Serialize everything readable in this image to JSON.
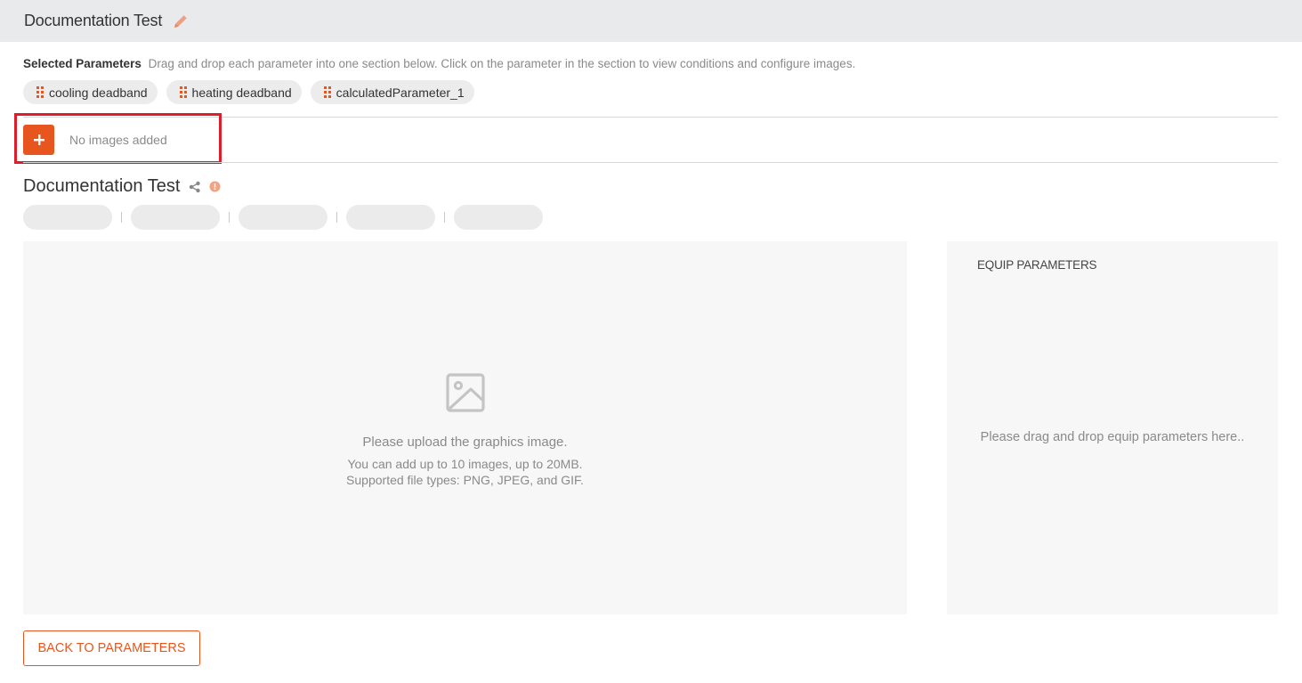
{
  "header": {
    "title": "Documentation Test",
    "edit_icon": "pencil-icon"
  },
  "selected": {
    "label": "Selected Parameters",
    "hint": "Drag and drop each parameter into one section below. Click on the parameter in the section to view conditions and configure images.",
    "chips": [
      {
        "label": "cooling deadband"
      },
      {
        "label": "heating deadband"
      },
      {
        "label": "calculatedParameter_1"
      }
    ]
  },
  "images": {
    "add_icon": "plus-icon",
    "empty_text": "No images added"
  },
  "section": {
    "title": "Documentation Test",
    "share_icon": "share-icon",
    "info_icon": "info-icon"
  },
  "canvas": {
    "icon": "image-icon",
    "line1": "Please upload the graphics image.",
    "line2": "You can add up to 10 images, up to 20MB.",
    "line3": "Supported file types: PNG, JPEG, and GIF."
  },
  "equip": {
    "heading": "EQUIP PARAMETERS",
    "message": "Please drag and drop equip parameters here.."
  },
  "footer": {
    "back_label": "BACK TO PARAMETERS"
  },
  "colors": {
    "accent": "#e8561f",
    "highlight": "#e11c2a",
    "header_bg": "#e9eaec",
    "panel_bg": "#f7f7f7"
  }
}
